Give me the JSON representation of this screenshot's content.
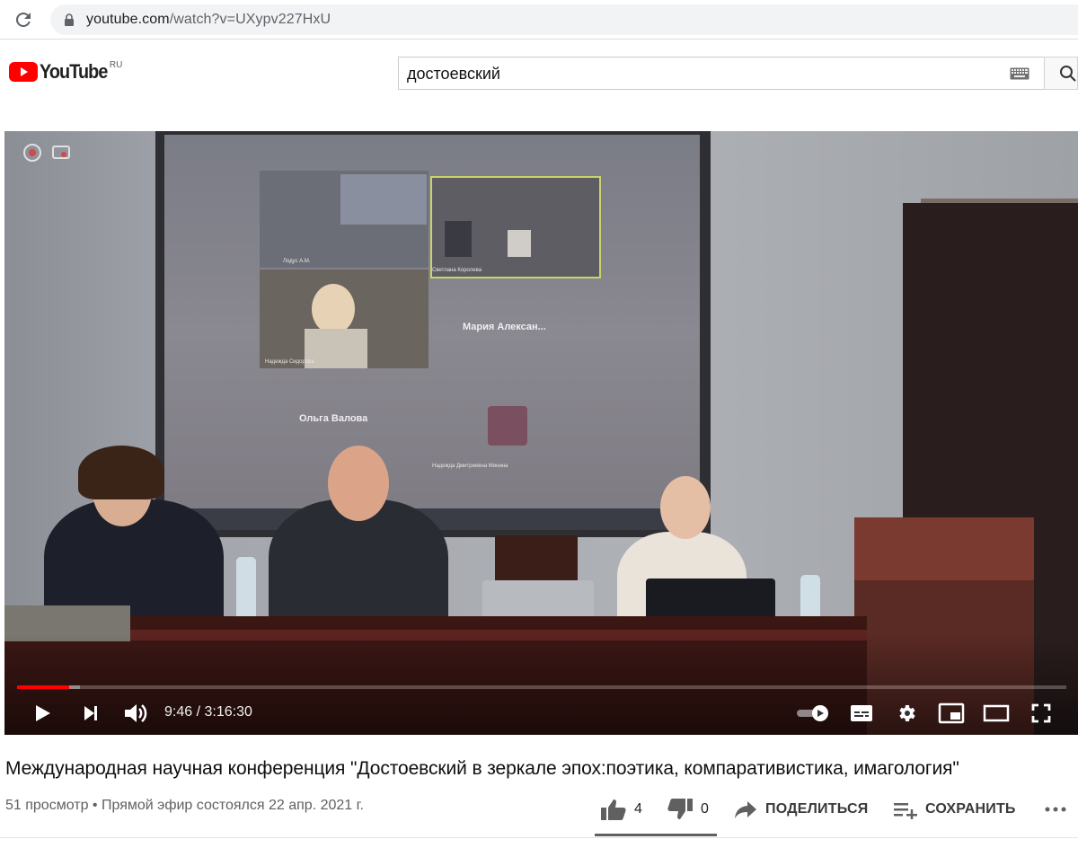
{
  "browser": {
    "url_host": "youtube.com",
    "url_path": "/watch?v=UXypv227HxU"
  },
  "header": {
    "logo_text": "YouTube",
    "logo_region": "RU",
    "search_value": "достоевский"
  },
  "video": {
    "screen_labels": {
      "tile1_name": "Лодус А.М.",
      "tile2_name": "Светлана Королева",
      "tile3_name": "Надежда Сидорова",
      "participant_maria": "Мария Алексан...",
      "participant_olga": "Ольга Валова",
      "participant_nadezhda": "Надежда Дмитриевна Минина"
    },
    "progress_played_fraction": 0.0499,
    "time_current": "9:46",
    "time_separator": " / ",
    "time_total": "3:16:30"
  },
  "controls": [
    {
      "name": "play-icon"
    },
    {
      "name": "next-icon"
    },
    {
      "name": "volume-icon"
    },
    {
      "name": "autoplay-toggle-icon"
    },
    {
      "name": "subtitles-icon"
    },
    {
      "name": "settings-gear-icon"
    },
    {
      "name": "miniplayer-icon"
    },
    {
      "name": "theater-mode-icon"
    },
    {
      "name": "fullscreen-icon"
    }
  ],
  "info": {
    "title": "Международная научная конференция \"Достоевский в зеркале эпох:поэтика, компаративистика, имагология\"",
    "views": "51 просмотр",
    "separator": " • ",
    "stream_date": "Прямой эфир состоялся 22 апр. 2021 г.",
    "likes": "4",
    "dislikes": "0",
    "share_label": "ПОДЕЛИТЬСЯ",
    "save_label": "СОХРАНИТЬ",
    "like_ratio": 1.0
  }
}
